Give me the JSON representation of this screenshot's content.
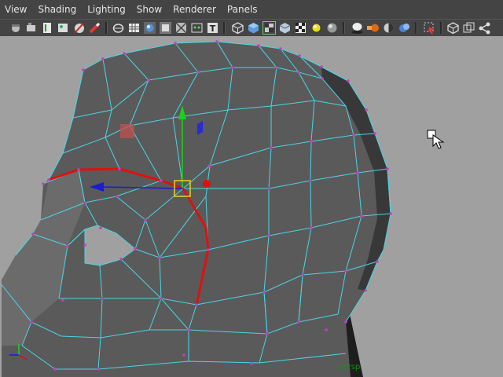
{
  "menu": {
    "items": [
      "View",
      "Shading",
      "Lighting",
      "Show",
      "Renderer",
      "Panels"
    ]
  },
  "toolbar": {
    "icons": [
      "camera-select-icon",
      "camera-attributes-icon",
      "bookmarks-icon",
      "image-plane-icon",
      "grease-pencil-icon",
      "wireframe-icon",
      "grid-icon",
      "film-gate-icon",
      "resolution-gate-icon",
      "field-chart-icon",
      "safe-action-icon",
      "safe-title-icon",
      "wireframe-shading-icon",
      "smooth-shade-icon",
      "wireframe-on-shaded-icon",
      "default-material-icon",
      "textured-icon",
      "use-all-lights-icon",
      "shadows-icon",
      "screen-space-ao-icon",
      "motion-blur-icon",
      "multisample-aa-icon",
      "depth-of-field-icon",
      "isolate-select-icon",
      "xray-icon",
      "xray-active-components-icon",
      "xray-joints-icon"
    ]
  },
  "viewport": {
    "camera_label": "persp",
    "colors": {
      "background": "#a0a0a0",
      "mesh_face": "#5b5b5b",
      "mesh_edge": "#49d6e6",
      "vertex": "#c040c0",
      "selected_edge": "#e01010",
      "manip_y": "#19d319",
      "manip_x": "#1b1bd6",
      "manip_z": "#e01010",
      "manip_center": "#e8d21b"
    }
  }
}
